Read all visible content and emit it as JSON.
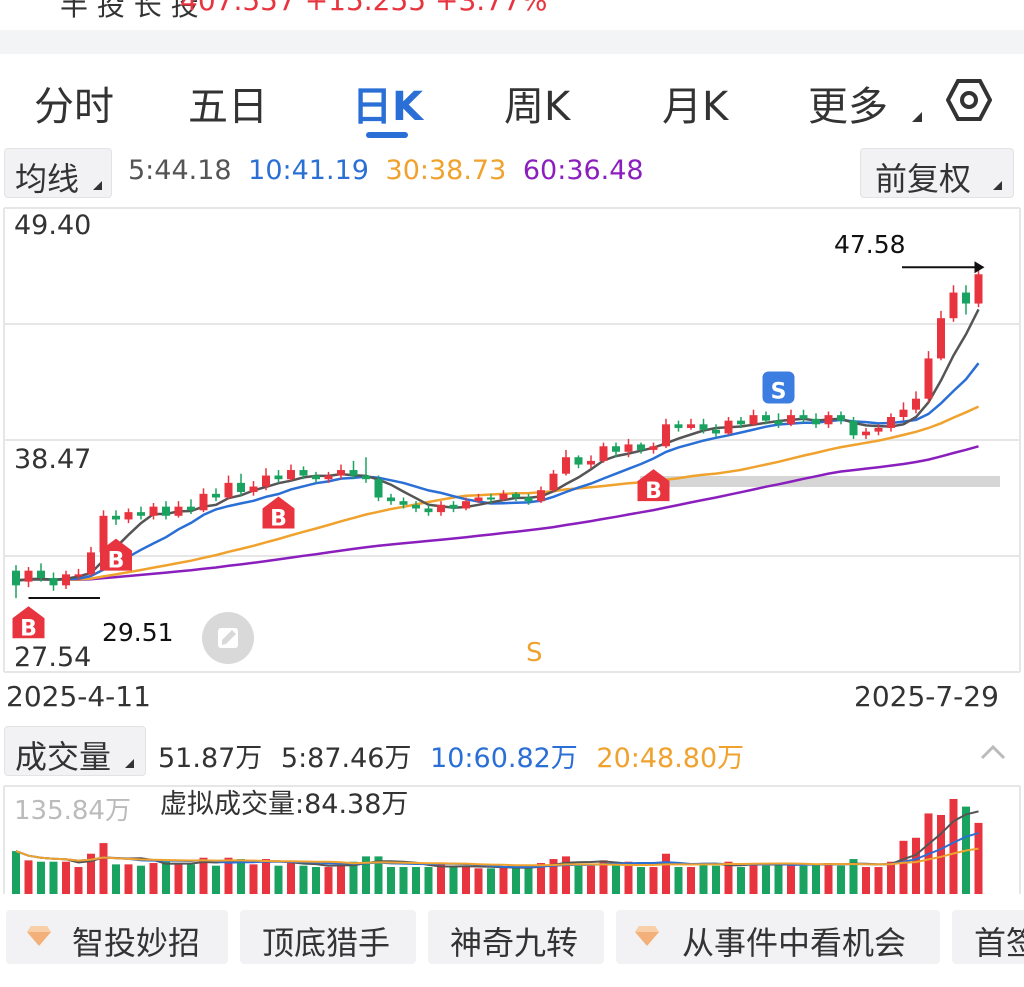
{
  "tabs": [
    {
      "label": "分时"
    },
    {
      "label": "五日"
    },
    {
      "label": "日K"
    },
    {
      "label": "周K"
    },
    {
      "label": "月K"
    },
    {
      "label": "更多"
    }
  ],
  "icons": {
    "settings": "hexagon-settings-icon",
    "switch": "edit-switch-icon"
  },
  "ma": {
    "selector": "均线",
    "values": [
      {
        "text": "5:44.18",
        "color": "#555555"
      },
      {
        "text": "10:41.19",
        "color": "#2a6fd6"
      },
      {
        "text": "30:38.73",
        "color": "#f0a22e"
      },
      {
        "text": "60:36.48",
        "color": "#8b1fbd"
      }
    ],
    "adjust": "前复权"
  },
  "price_axis": {
    "high": "49.40",
    "mid": "38.47",
    "low": "27.54"
  },
  "annotations": {
    "max": "47.58",
    "min": "29.51",
    "s_marker": "S"
  },
  "dates": {
    "start": "2025-4-11",
    "end": "2025-7-29"
  },
  "volume": {
    "selector": "成交量",
    "values": [
      {
        "text": "51.87万",
        "color": "#333333"
      },
      {
        "text": "5:87.46万",
        "color": "#333333"
      },
      {
        "text": "10:60.82万",
        "color": "#2a6fd6"
      },
      {
        "text": "20:48.80万",
        "color": "#f0a22e"
      }
    ],
    "max_label": "135.84万",
    "virtual": "虚拟成交量:84.38万"
  },
  "chips": [
    {
      "label": "智投妙招"
    },
    {
      "label": "顶底猎手"
    },
    {
      "label": "神奇九转"
    },
    {
      "label": "从事件中看机会"
    },
    {
      "label": "首签"
    }
  ],
  "colors": {
    "up": "#e8343f",
    "down": "#1aa260",
    "ma5": "#555555",
    "ma10": "#2a6fd6",
    "ma30": "#f0a22e",
    "ma60": "#8b1fbd",
    "accent": "#2a6fd6"
  },
  "chart_data": {
    "type": "candlestick",
    "ylim": [
      27.54,
      49.4
    ],
    "x_start": "2025-4-11",
    "x_end": "2025-7-29",
    "candles": [
      [
        31.0,
        30.2,
        31.3,
        29.5
      ],
      [
        30.4,
        31.0,
        31.2,
        30.1
      ],
      [
        31.0,
        30.6,
        31.4,
        30.4
      ],
      [
        30.6,
        30.2,
        30.9,
        29.9
      ],
      [
        30.2,
        30.8,
        31.0,
        30.0
      ],
      [
        30.8,
        30.8,
        31.1,
        30.5
      ],
      [
        30.8,
        32.0,
        32.3,
        30.7
      ],
      [
        32.0,
        34.0,
        34.3,
        31.9
      ],
      [
        34.0,
        33.8,
        34.3,
        33.5
      ],
      [
        33.8,
        34.2,
        34.4,
        33.6
      ],
      [
        34.2,
        34.0,
        34.5,
        33.8
      ],
      [
        34.0,
        34.5,
        34.7,
        33.8
      ],
      [
        34.5,
        34.0,
        34.8,
        33.8
      ],
      [
        34.0,
        34.5,
        34.8,
        33.9
      ],
      [
        34.5,
        34.3,
        34.9,
        34.1
      ],
      [
        34.3,
        35.2,
        35.5,
        34.2
      ],
      [
        35.2,
        35.0,
        35.5,
        34.8
      ],
      [
        35.0,
        35.8,
        36.2,
        34.9
      ],
      [
        35.8,
        35.3,
        36.3,
        35.1
      ],
      [
        35.3,
        35.6,
        35.9,
        35.1
      ],
      [
        35.6,
        36.2,
        36.6,
        35.4
      ],
      [
        36.2,
        36.0,
        36.5,
        35.8
      ],
      [
        36.0,
        36.5,
        36.8,
        35.9
      ],
      [
        36.5,
        36.2,
        36.7,
        36.0
      ],
      [
        36.2,
        36.0,
        36.4,
        35.8
      ],
      [
        36.0,
        36.2,
        36.4,
        35.8
      ],
      [
        36.2,
        36.5,
        36.8,
        36.0
      ],
      [
        36.5,
        36.2,
        37.0,
        36.0
      ],
      [
        36.2,
        36.0,
        37.2,
        35.8
      ],
      [
        36.0,
        35.0,
        36.2,
        34.8
      ],
      [
        35.0,
        34.8,
        35.2,
        34.6
      ],
      [
        34.8,
        34.6,
        35.0,
        34.4
      ],
      [
        34.6,
        34.4,
        34.8,
        34.2
      ],
      [
        34.4,
        34.2,
        34.6,
        34.0
      ],
      [
        34.2,
        34.6,
        34.8,
        34.0
      ],
      [
        34.6,
        34.4,
        34.8,
        34.2
      ],
      [
        34.4,
        34.8,
        35.0,
        34.3
      ],
      [
        34.8,
        35.0,
        35.2,
        34.7
      ],
      [
        35.0,
        34.9,
        35.2,
        34.7
      ],
      [
        34.9,
        35.2,
        35.4,
        34.8
      ],
      [
        35.2,
        35.0,
        35.3,
        34.8
      ],
      [
        35.0,
        34.8,
        35.2,
        34.6
      ],
      [
        34.8,
        35.4,
        35.6,
        34.7
      ],
      [
        35.4,
        36.3,
        36.5,
        35.3
      ],
      [
        36.3,
        37.2,
        37.6,
        36.2
      ],
      [
        37.2,
        36.8,
        37.3,
        36.6
      ],
      [
        36.8,
        37.0,
        37.3,
        36.6
      ],
      [
        37.0,
        37.8,
        38.0,
        36.9
      ],
      [
        37.8,
        37.5,
        38.0,
        37.2
      ],
      [
        37.5,
        37.9,
        38.2,
        37.2
      ],
      [
        37.9,
        37.6,
        38.0,
        37.4
      ],
      [
        37.6,
        37.8,
        38.0,
        37.4
      ],
      [
        37.8,
        39.0,
        39.3,
        37.7
      ],
      [
        39.0,
        38.8,
        39.2,
        38.6
      ],
      [
        38.8,
        39.0,
        39.3,
        38.7
      ],
      [
        39.0,
        38.7,
        39.3,
        38.5
      ],
      [
        38.7,
        38.5,
        39.0,
        38.3
      ],
      [
        38.5,
        39.2,
        39.4,
        38.4
      ],
      [
        39.2,
        39.0,
        39.4,
        38.8
      ],
      [
        39.0,
        39.5,
        39.8,
        38.9
      ],
      [
        39.5,
        39.2,
        39.7,
        39.0
      ],
      [
        39.2,
        39.0,
        39.6,
        38.8
      ],
      [
        39.0,
        39.5,
        39.8,
        38.9
      ],
      [
        39.5,
        39.3,
        39.8,
        39.1
      ],
      [
        39.3,
        39.0,
        39.6,
        38.8
      ],
      [
        39.0,
        39.5,
        39.7,
        38.8
      ],
      [
        39.5,
        39.2,
        39.7,
        39.0
      ],
      [
        39.2,
        38.4,
        39.4,
        38.2
      ],
      [
        38.4,
        38.6,
        38.8,
        38.2
      ],
      [
        38.6,
        38.8,
        39.0,
        38.4
      ],
      [
        38.8,
        39.4,
        39.6,
        38.6
      ],
      [
        39.4,
        39.8,
        40.2,
        39.2
      ],
      [
        39.8,
        40.4,
        40.8,
        39.6
      ],
      [
        40.4,
        42.6,
        43.0,
        40.2
      ],
      [
        42.6,
        44.8,
        45.2,
        42.5
      ],
      [
        44.8,
        46.2,
        46.6,
        44.6
      ],
      [
        46.2,
        45.6,
        46.6,
        45.0
      ],
      [
        45.6,
        47.2,
        47.58,
        45.4
      ]
    ]
  }
}
